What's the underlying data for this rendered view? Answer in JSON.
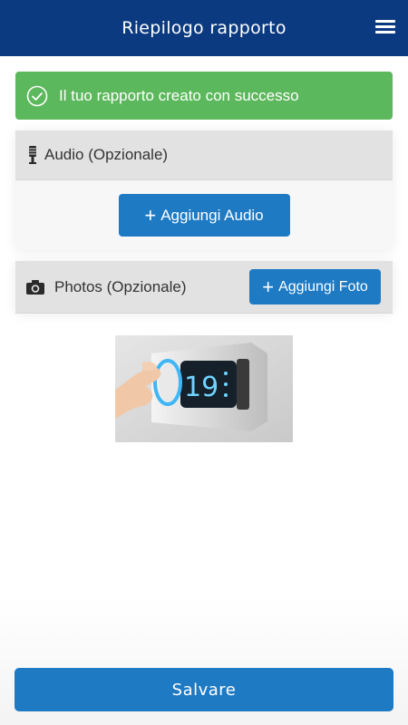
{
  "header": {
    "title": "Riepilogo rapporto",
    "menu_icon": "hamburger-menu-icon"
  },
  "alert": {
    "message": "Il tuo rapporto creato con successo",
    "icon": "check-circle-icon",
    "color": "#5cb85c"
  },
  "audio_section": {
    "label": "Audio (Opzionale)",
    "icon": "microphone-icon",
    "button_label": "Aggiungi Audio",
    "button_icon": "plus-icon"
  },
  "photo_section": {
    "label": "Photos (Opzionale)",
    "icon": "camera-icon",
    "button_label": "Aggiungi Foto",
    "button_icon": "plus-icon"
  },
  "photo": {
    "display_value": "19"
  },
  "footer": {
    "save_label": "Salvare"
  },
  "colors": {
    "header": "#0b3a80",
    "primary": "#1f7ac4",
    "success": "#5cb85c"
  }
}
